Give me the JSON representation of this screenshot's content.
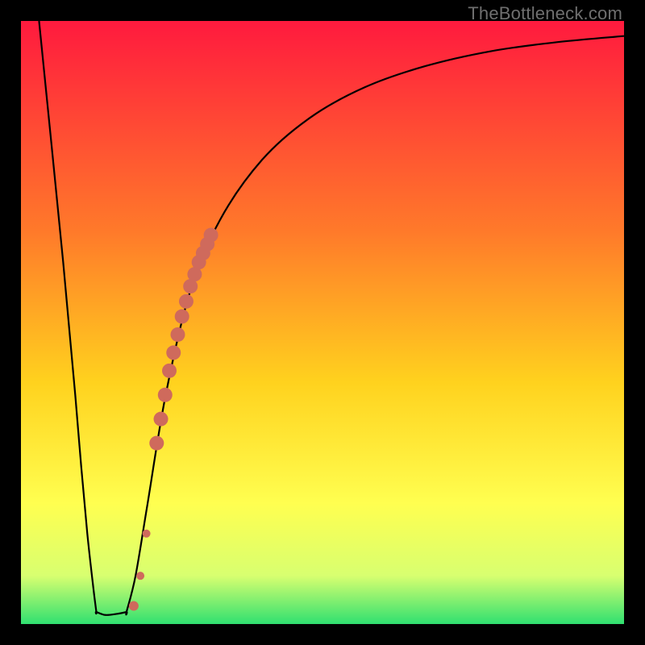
{
  "watermark": "TheBottleneck.com",
  "colors": {
    "frame": "#000000",
    "gradient_top": "#ff1a3e",
    "gradient_mid1": "#ff7a2a",
    "gradient_mid2": "#ffd21e",
    "gradient_mid3": "#ffff50",
    "gradient_mid4": "#d8ff70",
    "gradient_bottom": "#30e070",
    "curve": "#000000",
    "marker": "#cf6a5c"
  },
  "chart_data": {
    "type": "line",
    "title": "",
    "xlabel": "",
    "ylabel": "",
    "xlim": [
      0,
      100
    ],
    "ylim": [
      0,
      100
    ],
    "series": [
      {
        "name": "left-branch",
        "x": [
          3,
          7,
          9,
          10,
          11,
          12,
          12.5
        ],
        "values": [
          100,
          60,
          38,
          26,
          15,
          6,
          2
        ]
      },
      {
        "name": "valley-floor",
        "x": [
          12.5,
          14,
          16,
          17.5
        ],
        "values": [
          2,
          1.5,
          1.7,
          2
        ]
      },
      {
        "name": "right-branch",
        "x": [
          17.5,
          19,
          21,
          24,
          28,
          33,
          40,
          48,
          57,
          67,
          78,
          89,
          100
        ],
        "values": [
          2,
          8,
          20,
          38,
          55,
          67,
          77,
          84,
          89,
          92.5,
          95,
          96.5,
          97.5
        ]
      }
    ],
    "markers": {
      "name": "highlighted-points",
      "x": [
        18.7,
        19.8,
        20.8,
        22.5,
        23.2,
        23.9,
        24.6,
        25.3,
        26.0,
        26.7,
        27.4,
        28.1,
        28.8,
        29.5,
        30.2,
        30.9,
        31.5
      ],
      "values": [
        3,
        8,
        15,
        30,
        34,
        38,
        42,
        45,
        48,
        51,
        53.5,
        56,
        58,
        60,
        61.5,
        63,
        64.5
      ],
      "sizes": [
        6,
        5,
        5,
        9,
        9,
        9,
        9,
        9,
        9,
        9,
        9,
        9,
        9,
        9,
        9,
        9,
        9
      ]
    }
  }
}
